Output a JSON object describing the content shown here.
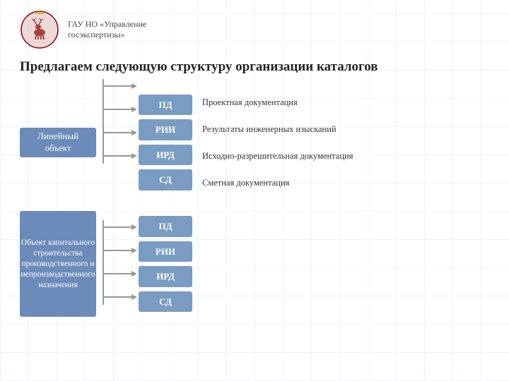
{
  "header": {
    "org_line1": "ГАУ НО «Управление",
    "org_line2": "госэкспертизы»"
  },
  "page": {
    "title": "Предлагаем следующую структуру организации каталогов"
  },
  "row1": {
    "left_label": "Линейный объект",
    "items": [
      {
        "code": "ПД",
        "description": "Проектная документация"
      },
      {
        "code": "РИИ",
        "description": "Результаты инженерных изысканий"
      },
      {
        "code": "ИРД",
        "description": "Исходно-разрешительная документация"
      },
      {
        "code": "СД",
        "description": "Сметная документация"
      }
    ]
  },
  "row2": {
    "left_label": "Объект капитального строительства производственного и непроизводственного назначения",
    "items": [
      {
        "code": "ПД",
        "description": ""
      },
      {
        "code": "РИИ",
        "description": ""
      },
      {
        "code": "ИРД",
        "description": ""
      },
      {
        "code": "СД",
        "description": ""
      }
    ]
  },
  "colors": {
    "box_bg": "#7a9cc2",
    "arrow": "#999999",
    "text_dark": "#333333",
    "text_white": "#ffffff"
  }
}
